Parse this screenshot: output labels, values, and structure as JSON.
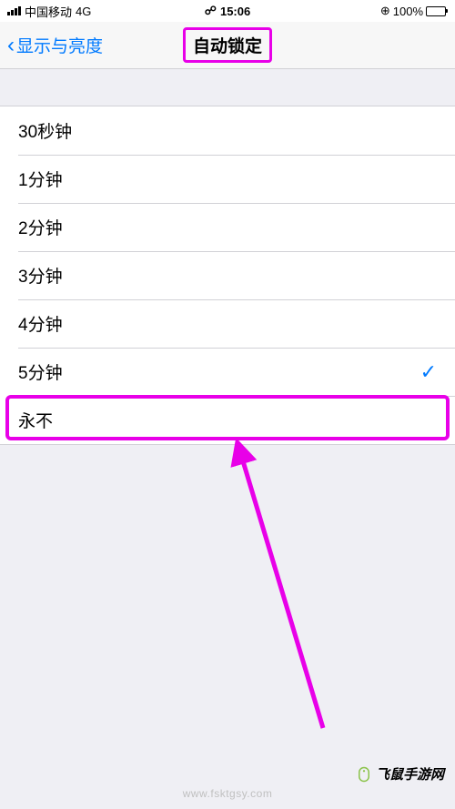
{
  "status": {
    "carrier": "中国移动",
    "network": "4G",
    "time": "15:06",
    "battery_pct": "100%",
    "orientation_lock": "⊕"
  },
  "nav": {
    "back_label": "显示与亮度",
    "title": "自动锁定"
  },
  "options": [
    {
      "label": "30秒钟",
      "selected": false
    },
    {
      "label": "1分钟",
      "selected": false
    },
    {
      "label": "2分钟",
      "selected": false
    },
    {
      "label": "3分钟",
      "selected": false
    },
    {
      "label": "4分钟",
      "selected": false
    },
    {
      "label": "5分钟",
      "selected": true
    },
    {
      "label": "永不",
      "selected": false
    }
  ],
  "watermark": {
    "brand": "飞鼠手游网",
    "url": "www.fsktgsy.com"
  },
  "annotation": {
    "highlight_color": "#e800e8"
  }
}
